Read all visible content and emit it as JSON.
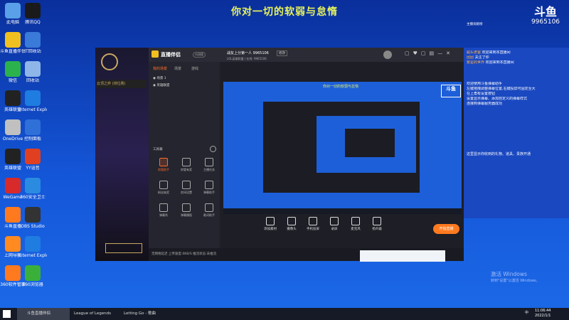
{
  "caption": "你对一切的软弱与怠惰",
  "desktop_icons": [
    {
      "label": "此电脑",
      "color": "#5aa0e8"
    },
    {
      "label": "腾讯QQ",
      "color": "#1a1a1a"
    },
    {
      "label": "斗鱼直播伴侣",
      "color": "#f0c020"
    },
    {
      "label": "IT回收站",
      "color": "#3a7ad8"
    },
    {
      "label": "微信",
      "color": "#2bb24c"
    },
    {
      "label": "回收站",
      "color": "#8fb6e8"
    },
    {
      "label": "英雄联盟",
      "color": "#222"
    },
    {
      "label": "Internet Explorer",
      "color": "#1f7ce0"
    },
    {
      "label": "OneDrive",
      "color": "#c0c0c0"
    },
    {
      "label": "控制面板",
      "color": "#2f6fd8"
    },
    {
      "label": "英雄联盟",
      "color": "#222"
    },
    {
      "label": "YY语音",
      "color": "#e04020"
    },
    {
      "label": "WeGame",
      "color": "#d82a2a"
    },
    {
      "label": "360安全卫士",
      "color": "#2a8be0"
    },
    {
      "label": "斗鱼直播",
      "color": "#ff7a1f"
    },
    {
      "label": "OBS Studio",
      "color": "#333"
    },
    {
      "label": "上网导航",
      "color": "#ff8a1f"
    },
    {
      "label": "Internet Explorer",
      "color": "#1f7ce0"
    },
    {
      "label": "360软件管家",
      "color": "#ff7a1f"
    },
    {
      "label": "360浏览器",
      "color": "#3ab03a"
    }
  ],
  "app": {
    "brand": "直播伴侣",
    "version_badge": "内测版",
    "room_title": "战友上分第一人 9965106",
    "room_badge": "修改",
    "room_meta": "LOL英雄联盟 | 在线: 9965106",
    "tabs": [
      "我的场景",
      "场景",
      "游戏"
    ],
    "scenes": [
      "场景 1",
      "英雄联盟"
    ],
    "tools_header": "工具箱",
    "tools": [
      "房管助手",
      "房管有奖",
      "主播任务",
      "粉丝抽奖",
      "房间设置",
      "弹幕助手",
      "弹幕秀",
      "弹幕播报",
      "歌词助手"
    ],
    "controls": [
      "添加素材",
      "摄像头",
      "手机投屏",
      "录屏",
      "麦克风",
      "扬声器"
    ],
    "go_live": "开始直播",
    "status": "无网络延迟  上传速度:0KB/S  推流状态:未推流",
    "preview_caption": "你对一切的软弱与怠惰"
  },
  "logo": {
    "text": "斗鱼",
    "id": "9965106"
  },
  "chat": {
    "header": "主播贡献榜",
    "messages": [
      {
        "user": "聪头老爸",
        "text": "欢迎来到本直播间"
      },
      {
        "user": "团团",
        "text": "关注了你"
      },
      {
        "user": "繁星的世界",
        "text": "欢迎来到本直播间"
      }
    ],
    "system": [
      "欢迎使用斗鱼弹幕助手",
      "左键拖拽调整弹幕位置,右键投屏可固定至大",
      "在上角有设置按钮",
      "设置显示弹幕、添加自定义的弹幕样式",
      "连接到弹幕服务器成功"
    ],
    "notice": "这里显示你收到的礼物、道具、贵族开通"
  },
  "watermark": {
    "line1": "激活 Windows",
    "line2": "转到\"设置\"以激活 Windows。"
  },
  "taskbar": {
    "items": [
      "斗鱼直播伴侣",
      "League of Legends",
      "Letting Go - 歌曲"
    ],
    "time": "11:06:44",
    "date": "2022/1/1",
    "lang": "中"
  }
}
